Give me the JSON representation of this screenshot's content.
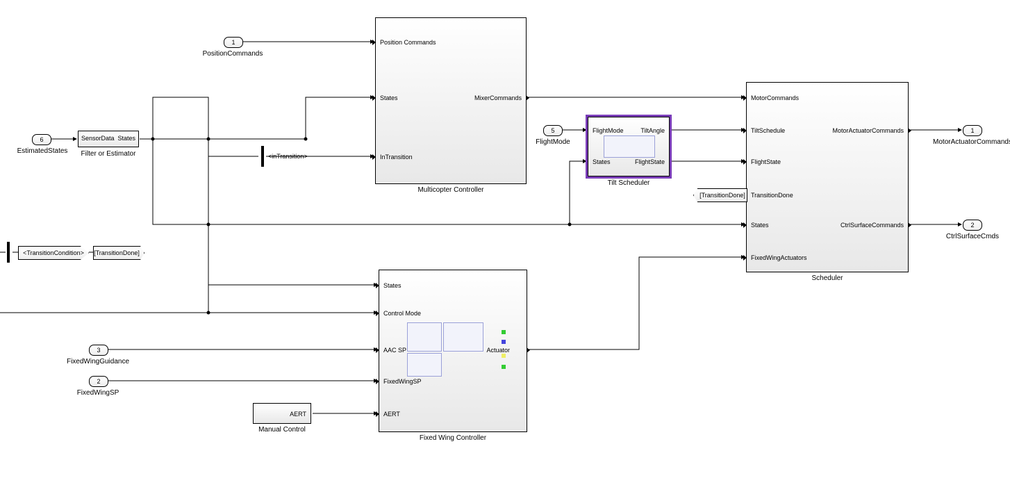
{
  "inports": {
    "p1": {
      "num": "1",
      "label": "PositionCommands"
    },
    "p2": {
      "num": "2",
      "label": "FixedWingSP"
    },
    "p3": {
      "num": "3",
      "label": "FixedWingGuidance"
    },
    "p5": {
      "num": "5",
      "label": "FlightMode"
    },
    "p6": {
      "num": "6",
      "label": "EstimatedStates"
    }
  },
  "outports": {
    "o1": {
      "num": "1",
      "label": "MotorActuatorCommands"
    },
    "o2": {
      "num": "2",
      "label": "CtrlSurfaceCmds"
    }
  },
  "blocks": {
    "filter": {
      "title": "Filter or Estimator",
      "in": [
        "SensorData"
      ],
      "out": [
        "States"
      ]
    },
    "multicopter": {
      "title": "Multicopter Controller",
      "in": [
        "Position Commands",
        "States",
        "InTransition"
      ],
      "out": [
        "MixerCommands"
      ]
    },
    "tilt": {
      "title": "Tilt Scheduler",
      "in": [
        "FlightMode",
        "States"
      ],
      "out": [
        "TiltAngle",
        "FlightState"
      ]
    },
    "fixedwing": {
      "title": "Fixed Wing Controller",
      "in": [
        "States",
        "Control Mode",
        "AAC SP",
        "FixedWingSP",
        "AERT"
      ],
      "out": [
        "Actuator"
      ]
    },
    "scheduler": {
      "title": "Scheduler",
      "in": [
        "MotorCommands",
        "TiltSchedule",
        "FlightState",
        "TransitionDone",
        "States",
        "FixedWingActuators"
      ],
      "out": [
        "MotorActuatorCommands",
        "CtrlSurfaceCommands"
      ]
    },
    "manual": {
      "title": "Manual Control",
      "out": [
        "AERT"
      ]
    }
  },
  "tags": {
    "trans_done_goto": "[TransitionDone]",
    "trans_done_from": "[TransitionDone]",
    "trans_cond_sel": "<TransitionCondition>",
    "in_transition_sel": "<inTransition>"
  }
}
